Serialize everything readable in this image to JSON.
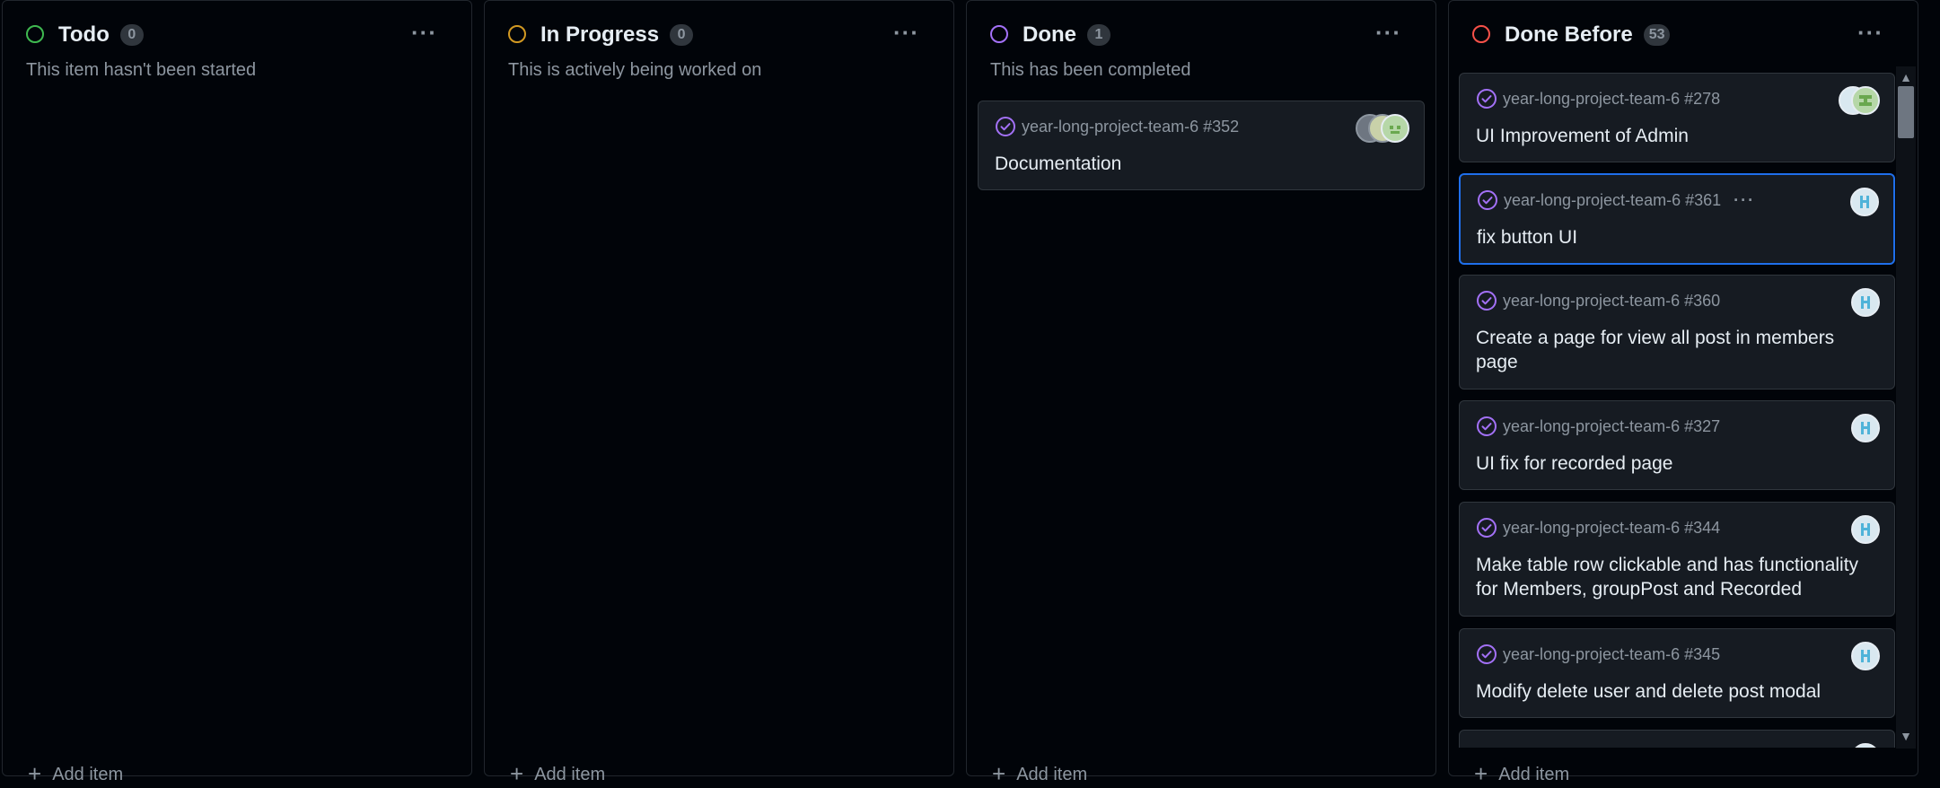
{
  "columns": [
    {
      "title": "Todo",
      "count": "0",
      "description": "This item hasn't been started",
      "status_color": "#3fb950",
      "menu_icon": "kebab-horizontal-icon",
      "add_label": "Add item"
    },
    {
      "title": "In Progress",
      "count": "0",
      "description": "This is actively being worked on",
      "status_color": "#d29922",
      "menu_icon": "kebab-horizontal-icon",
      "add_label": "Add item"
    },
    {
      "title": "Done",
      "count": "1",
      "description": "This has been completed",
      "status_color": "#a371f7",
      "menu_icon": "kebab-horizontal-icon",
      "add_label": "Add item",
      "cards": [
        {
          "meta": "year-long-project-team-6 #352",
          "title": "Documentation",
          "icon": "closed-issue-check-icon"
        }
      ]
    },
    {
      "title": "Done Before",
      "count": "53",
      "description": "",
      "status_color": "#f85149",
      "menu_icon": "kebab-horizontal-icon",
      "add_label": "Add item",
      "cards": [
        {
          "meta": "year-long-project-team-6 #278",
          "title": "UI Improvement of Admin",
          "icon": "closed-issue-check-icon"
        },
        {
          "meta": "year-long-project-team-6 #361",
          "title": "fix button UI",
          "icon": "closed-issue-check-icon",
          "selected": true
        },
        {
          "meta": "year-long-project-team-6 #360",
          "title": "Create a page for view all post in members page",
          "icon": "closed-issue-check-icon"
        },
        {
          "meta": "year-long-project-team-6 #327",
          "title": "UI fix for recorded page",
          "icon": "closed-issue-check-icon"
        },
        {
          "meta": "year-long-project-team-6 #344",
          "title": "Make table row clickable and has functionality for Members, groupPost and Recorded",
          "icon": "closed-issue-check-icon"
        },
        {
          "meta": "year-long-project-team-6 #345",
          "title": "Modify delete user and delete post modal",
          "icon": "closed-issue-check-icon"
        }
      ]
    }
  ],
  "card_more_icon": "kebab-horizontal-icon",
  "colors": {
    "background": "#010409",
    "card": "#161b22",
    "border": "#30363d",
    "accent": "#1f6feb",
    "done_purple": "#a371f7"
  }
}
